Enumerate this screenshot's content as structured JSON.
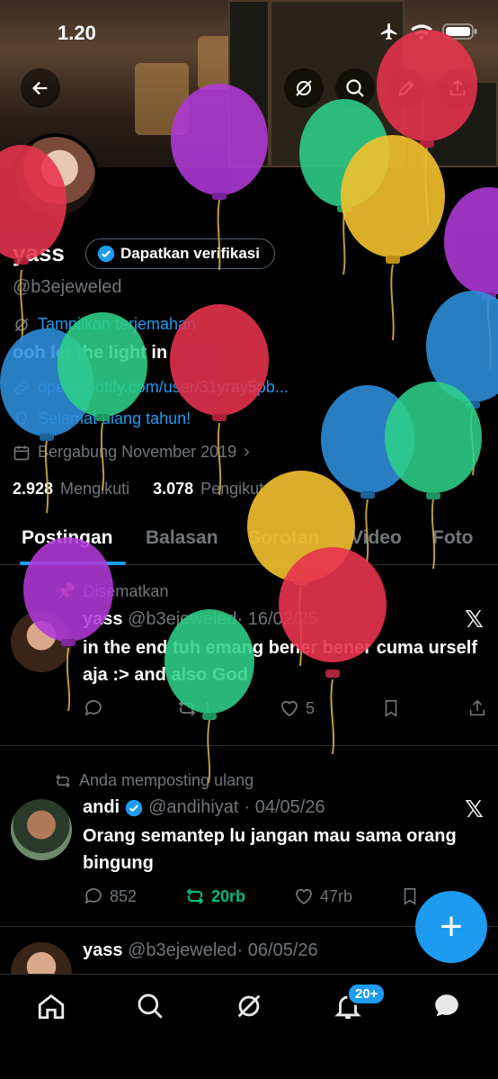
{
  "status": {
    "time": "1.20"
  },
  "profile": {
    "name": "yass",
    "verify_label": "Dapatkan verifikasi",
    "handle": "@b3ejeweled",
    "translate_label": "Tampilkan terjemahan",
    "bio": "ooh let the light in",
    "link": "open.spotify.com/user/31yray5pb...",
    "birthday": "Selamat ulang tahun!",
    "joined": "Bergabung November 2019",
    "following_count": "2.928",
    "following_label": "Mengikuti",
    "followers_count": "3.078",
    "followers_label": "Pengikut"
  },
  "tabs": [
    "Postingan",
    "Balasan",
    "Sorotan",
    "Video",
    "Foto"
  ],
  "posts": [
    {
      "context": "Disematkan",
      "name": "yass",
      "handle": "@b3ejeweled",
      "date": "· 16/02/25",
      "text": "in the end tuh emang bener bener cuma urself aja :> and also God",
      "replies": "",
      "reposts": "1",
      "likes": "5"
    },
    {
      "context": "Anda memposting ulang",
      "name": "andi",
      "handle": "@andihiyat",
      "date": "· 04/05/26",
      "text": "Orang semantep lu jangan mau sama orang bingung",
      "replies": "852",
      "reposts": "20rb",
      "likes": "47rb"
    },
    {
      "context": "",
      "name": "yass",
      "handle": "@b3ejeweled",
      "date": "· 06/05/26",
      "text": "",
      "replies": "",
      "reposts": "",
      "likes": ""
    }
  ],
  "fab_label": "+",
  "nav": {
    "notif_badge": "20+"
  },
  "colors": {
    "accent": "#1d9bf0",
    "repost_green": "#00ba7c",
    "background": "#000000"
  }
}
